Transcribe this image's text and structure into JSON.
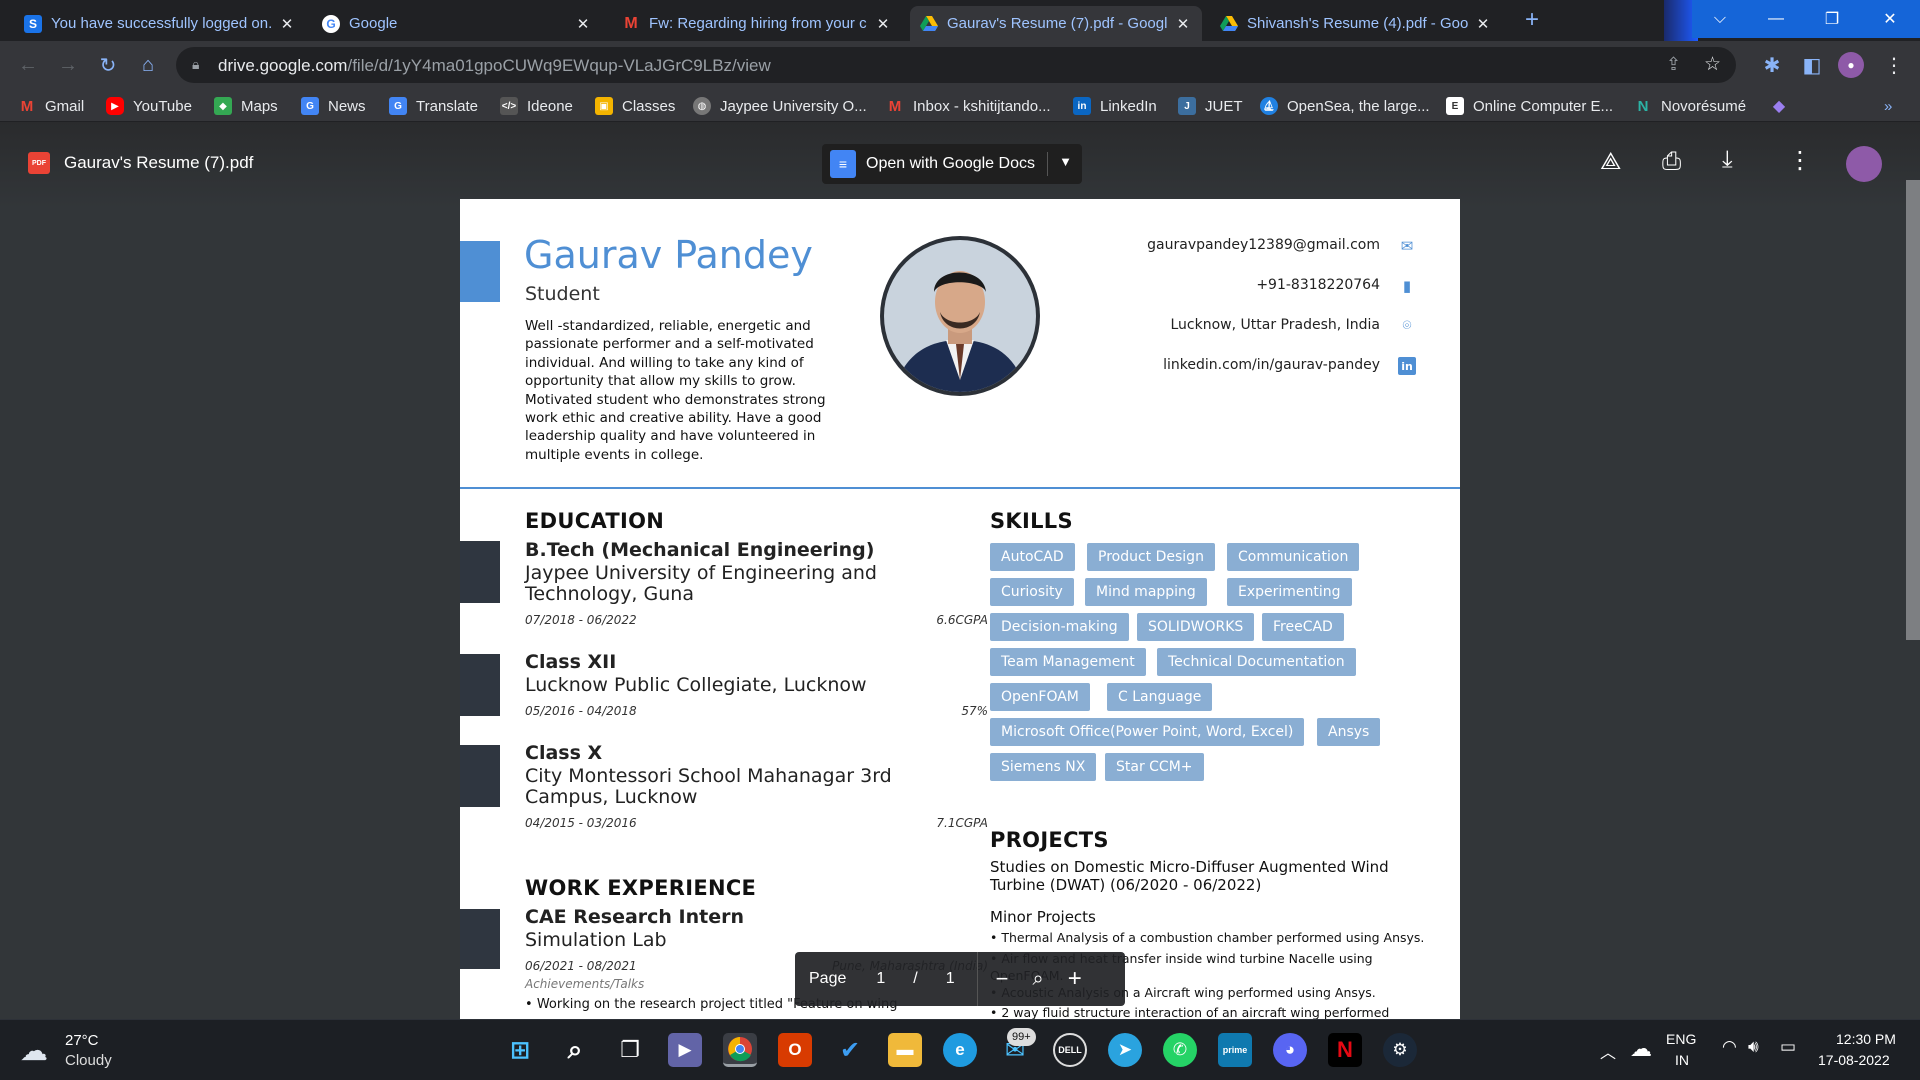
{
  "browser": {
    "tabs": [
      {
        "title": "You have successfully logged on.",
        "icon": "s-app-icon",
        "active": false
      },
      {
        "title": "Google",
        "icon": "google-icon",
        "active": false
      },
      {
        "title": "Fw: Regarding hiring from your c",
        "icon": "gmail-icon",
        "active": false
      },
      {
        "title": "Gaurav's Resume (7).pdf - Googl",
        "icon": "drive-icon",
        "active": true
      },
      {
        "title": "Shivansh's Resume (4).pdf - Goo",
        "icon": "drive-icon",
        "active": false
      }
    ],
    "new_tab": "+",
    "url_host": "drive.google.com",
    "url_path": "/file/d/1yY4ma01gpoCUWq9EWqup-VLaJGrC9LBz/view",
    "bookmarks": [
      "Gmail",
      "YouTube",
      "Maps",
      "News",
      "Translate",
      "Ideone",
      "Classes",
      "Jaypee University O...",
      "Inbox - kshitijtando...",
      "LinkedIn",
      "JUET",
      "OpenSea, the large...",
      "Online Computer E...",
      "Novorésumé"
    ],
    "bookmarks_more": "»"
  },
  "viewer": {
    "file_name": "Gaurav's Resume (7).pdf",
    "file_badge": "PDF",
    "open_with": "Open with Google Docs",
    "page_label": "Page",
    "page_current": "1",
    "page_sep": "/",
    "page_total": "1"
  },
  "resume": {
    "name": "Gaurav Pandey",
    "role": "Student",
    "summary": "Well -standardized, reliable, energetic and passionate performer and a self-motivated individual. And willing to take any kind of opportunity that allow my skills to grow. Motivated student who demonstrates strong work ethic and creative ability. Have a good leadership quality and have volunteered in multiple events in college.",
    "contact": {
      "email": "gauravpandey12389@gmail.com",
      "phone": "+91-8318220764",
      "location": "Lucknow, Uttar Pradesh, India",
      "linkedin": "linkedin.com/in/gaurav-pandey"
    },
    "education_title": "EDUCATION",
    "education": [
      {
        "degree": "B.Tech (Mechanical Engineering)",
        "school": "Jaypee University of Engineering and Technology, Guna",
        "dates": "07/2018 - 06/2022",
        "grade": "6.6CGPA"
      },
      {
        "degree": "Class XII",
        "school": "Lucknow Public Collegiate, Lucknow",
        "dates": "05/2016 - 04/2018",
        "grade": "57%"
      },
      {
        "degree": "Class X",
        "school": "City Montessori School Mahanagar 3rd Campus, Lucknow",
        "dates": "04/2015 - 03/2016",
        "grade": "7.1CGPA"
      }
    ],
    "work_title": "WORK EXPERIENCE",
    "work": {
      "role": "CAE Research Intern",
      "org": "Simulation Lab",
      "dates": "06/2021 - 08/2021",
      "location": "Pune, Maharashtra (India)",
      "sub": "Achievements/Talks",
      "bullet": "Working on the research project titled \"Feature on wing"
    },
    "skills_title": "SKILLS",
    "skills": [
      "AutoCAD",
      "Product Design",
      "Communication",
      "Curiosity",
      "Mind mapping",
      "Experimenting",
      "Decision-making",
      "SOLIDWORKS",
      "FreeCAD",
      "Team Management",
      "Technical Documentation",
      "OpenFOAM",
      "C Language",
      "Microsoft Office(Power Point, Word, Excel)",
      "Ansys",
      "Siemens NX",
      "Star CCM+"
    ],
    "projects_title": "PROJECTS",
    "project_main": "Studies on Domestic Micro-Diffuser Augmented Wind Turbine (DWAT) (06/2020 - 06/2022)",
    "minor_title": "Minor Projects",
    "minor": [
      "Thermal Analysis of a combustion chamber performed using Ansys.",
      "Air flow and heat transfer inside wind turbine Nacelle using OpenFOAM.",
      "Acoustic Analysis on a Aircraft wing performed using Ansys.",
      "2 way fluid structure interaction of an aircraft wing performed"
    ]
  },
  "taskbar": {
    "weather_temp": "27°C",
    "weather_desc": "Cloudy",
    "mail_badge": "99+",
    "lang1": "ENG",
    "lang2": "IN",
    "time": "12:30 PM",
    "date": "17-08-2022"
  },
  "colors": {
    "accent_blue": "#4f8fd4",
    "tag_blue": "#8aaed3",
    "dark_bar": "#2f3640"
  }
}
